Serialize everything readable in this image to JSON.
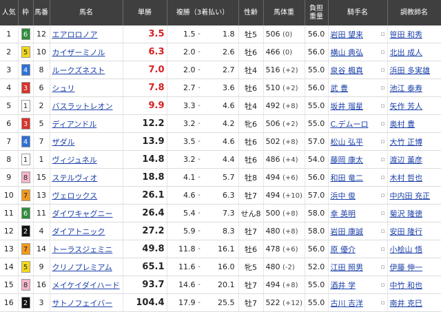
{
  "headers": {
    "ninki": "人気",
    "waku": "枠",
    "umaban": "馬番",
    "horse": "馬名",
    "tansho": "単勝",
    "fukusho": "複勝（3着払い）",
    "seirei": "性齢",
    "weight": "馬体重",
    "futan": "負担\n重量",
    "jockey": "騎手名",
    "trainer": "調教師名"
  },
  "waku_colors": {
    "1": {
      "bg": "#ffffff",
      "fg": "#222222"
    },
    "2": {
      "bg": "#111111",
      "fg": "#ffffff"
    },
    "3": {
      "bg": "#d8322c",
      "fg": "#ffffff"
    },
    "4": {
      "bg": "#2f6fd6",
      "fg": "#ffffff"
    },
    "5": {
      "bg": "#f2d81a",
      "fg": "#222222"
    },
    "6": {
      "bg": "#2f8c3c",
      "fg": "#ffffff"
    },
    "7": {
      "bg": "#f29a1d",
      "fg": "#222222"
    },
    "8": {
      "bg": "#f4b6c9",
      "fg": "#222222"
    }
  },
  "rows": [
    {
      "ninki": "1",
      "waku": "6",
      "umaban": "12",
      "horse": "エアロロノア",
      "tansho": "3.5",
      "fuku_lo": "1.5",
      "fuku_hi": "1.8",
      "seirei": "牡5",
      "weight": "506",
      "wdiff": "(0)",
      "futan": "56.0",
      "jockey": "岩田 望来",
      "trainer": "笹田 和秀",
      "hot": true
    },
    {
      "ninki": "2",
      "waku": "5",
      "umaban": "10",
      "horse": "カイザーミノル",
      "tansho": "6.3",
      "fuku_lo": "2.0",
      "fuku_hi": "2.6",
      "seirei": "牡6",
      "weight": "466",
      "wdiff": "(0)",
      "futan": "56.0",
      "jockey": "横山 典弘",
      "trainer": "北出 成人",
      "hot": true
    },
    {
      "ninki": "3",
      "waku": "4",
      "umaban": "8",
      "horse": "ルークズネスト",
      "tansho": "7.0",
      "fuku_lo": "2.0",
      "fuku_hi": "2.7",
      "seirei": "牡4",
      "weight": "516",
      "wdiff": "(+2)",
      "futan": "55.0",
      "jockey": "泉谷 楓真",
      "trainer": "浜田 多実雄",
      "hot": true
    },
    {
      "ninki": "4",
      "waku": "3",
      "umaban": "6",
      "horse": "シュリ",
      "tansho": "7.8",
      "fuku_lo": "2.7",
      "fuku_hi": "3.6",
      "seirei": "牡6",
      "weight": "510",
      "wdiff": "(+2)",
      "futan": "56.0",
      "jockey": "武 豊",
      "trainer": "池江 泰寿",
      "hot": true
    },
    {
      "ninki": "5",
      "waku": "1",
      "umaban": "2",
      "horse": "バスラットレオン",
      "tansho": "9.9",
      "fuku_lo": "3.3",
      "fuku_hi": "4.6",
      "seirei": "牡4",
      "weight": "492",
      "wdiff": "(+8)",
      "futan": "55.0",
      "jockey": "坂井 瑠星",
      "trainer": "矢作 芳人",
      "hot": true
    },
    {
      "ninki": "6",
      "waku": "3",
      "umaban": "5",
      "horse": "ディアンドル",
      "tansho": "12.2",
      "fuku_lo": "3.2",
      "fuku_hi": "4.2",
      "seirei": "牝6",
      "weight": "506",
      "wdiff": "(+2)",
      "futan": "55.0",
      "jockey": "C.デムーロ",
      "trainer": "奥村 豊",
      "hot": false
    },
    {
      "ninki": "7",
      "waku": "4",
      "umaban": "7",
      "horse": "ザダル",
      "tansho": "13.9",
      "fuku_lo": "3.5",
      "fuku_hi": "4.6",
      "seirei": "牡6",
      "weight": "502",
      "wdiff": "(+8)",
      "futan": "57.0",
      "jockey": "松山 弘平",
      "trainer": "大竹 正博",
      "hot": false
    },
    {
      "ninki": "8",
      "waku": "1",
      "umaban": "1",
      "horse": "ヴィジュネル",
      "tansho": "14.8",
      "fuku_lo": "3.2",
      "fuku_hi": "4.4",
      "seirei": "牡6",
      "weight": "486",
      "wdiff": "(+4)",
      "futan": "54.0",
      "jockey": "藤岡 康太",
      "trainer": "渡辺 薫彦",
      "hot": false
    },
    {
      "ninki": "9",
      "waku": "8",
      "umaban": "15",
      "horse": "ステルヴィオ",
      "tansho": "18.8",
      "fuku_lo": "4.1",
      "fuku_hi": "5.7",
      "seirei": "牡8",
      "weight": "494",
      "wdiff": "(+6)",
      "futan": "56.0",
      "jockey": "和田 竜二",
      "trainer": "木村 哲也",
      "hot": false
    },
    {
      "ninki": "10",
      "waku": "7",
      "umaban": "13",
      "horse": "ヴェロックス",
      "tansho": "26.1",
      "fuku_lo": "4.6",
      "fuku_hi": "6.3",
      "seirei": "牡7",
      "weight": "494",
      "wdiff": "(+10)",
      "futan": "57.0",
      "jockey": "浜中 俊",
      "trainer": "中内田 充正",
      "hot": false
    },
    {
      "ninki": "11",
      "waku": "6",
      "umaban": "11",
      "horse": "ダイワキャグニー",
      "tansho": "26.4",
      "fuku_lo": "5.4",
      "fuku_hi": "7.3",
      "seirei": "せん8",
      "weight": "500",
      "wdiff": "(+8)",
      "futan": "58.0",
      "jockey": "幸 英明",
      "trainer": "菊沢 隆徳",
      "hot": false
    },
    {
      "ninki": "12",
      "waku": "2",
      "umaban": "4",
      "horse": "ダイアトニック",
      "tansho": "27.2",
      "fuku_lo": "5.9",
      "fuku_hi": "8.3",
      "seirei": "牡7",
      "weight": "480",
      "wdiff": "(+8)",
      "futan": "58.0",
      "jockey": "岩田 康誠",
      "trainer": "安田 隆行",
      "hot": false
    },
    {
      "ninki": "13",
      "waku": "7",
      "umaban": "14",
      "horse": "トーラスジェミニ",
      "tansho": "49.8",
      "fuku_lo": "11.8",
      "fuku_hi": "16.1",
      "seirei": "牡6",
      "weight": "478",
      "wdiff": "(+6)",
      "futan": "56.0",
      "jockey": "原 優介",
      "trainer": "小桧山 悟",
      "hot": false
    },
    {
      "ninki": "14",
      "waku": "5",
      "umaban": "9",
      "horse": "クリノプレミアム",
      "tansho": "65.1",
      "fuku_lo": "11.6",
      "fuku_hi": "16.0",
      "seirei": "牝5",
      "weight": "480",
      "wdiff": "(-2)",
      "futan": "52.0",
      "jockey": "江田 照男",
      "trainer": "伊藤 伸一",
      "hot": false
    },
    {
      "ninki": "15",
      "waku": "8",
      "umaban": "16",
      "horse": "メイケイダイハード",
      "tansho": "93.7",
      "fuku_lo": "14.6",
      "fuku_hi": "20.1",
      "seirei": "牡7",
      "weight": "494",
      "wdiff": "(+8)",
      "futan": "55.0",
      "jockey": "酒井 学",
      "trainer": "中竹 和也",
      "hot": false
    },
    {
      "ninki": "16",
      "waku": "2",
      "umaban": "3",
      "horse": "サトノフェイバー",
      "tansho": "104.4",
      "fuku_lo": "17.9",
      "fuku_hi": "25.5",
      "seirei": "牡7",
      "weight": "522",
      "wdiff": "(+12)",
      "futan": "55.0",
      "jockey": "古川 吉洋",
      "trainer": "南井 克巳",
      "hot": false
    }
  ]
}
